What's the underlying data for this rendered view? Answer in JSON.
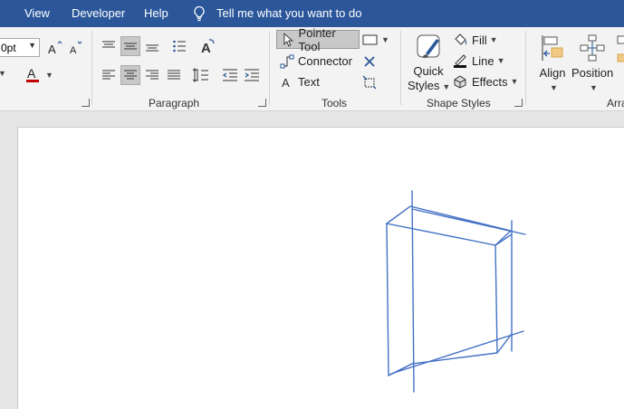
{
  "menubar": {
    "items": [
      "View",
      "Developer",
      "Help"
    ],
    "tellme": "Tell me what you want to do"
  },
  "font": {
    "size": "0pt"
  },
  "groups": {
    "paragraph": "Paragraph",
    "tools": "Tools",
    "shape_styles": "Shape Styles",
    "arrange": "Arra"
  },
  "tools": {
    "pointer": "Pointer Tool",
    "connector": "Connector",
    "text": "Text"
  },
  "shape_styles": {
    "quick_styles": [
      "Quick",
      "Styles"
    ],
    "fill": "Fill",
    "line": "Line",
    "effects": "Effects"
  },
  "arrange": {
    "align": "Align",
    "position": "Position"
  },
  "colors": {
    "menubar": "#2b579a",
    "font_color": "#c00000",
    "shape_stroke": "#4472c4"
  }
}
